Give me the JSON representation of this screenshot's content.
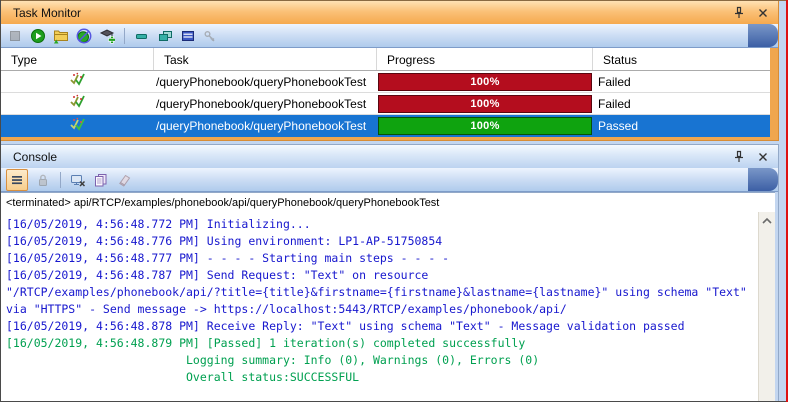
{
  "chrome": {
    "background_color": "#C3D6F0",
    "right_border_color": "#DE1212"
  },
  "task_monitor": {
    "title": "Task Monitor",
    "window_icons": [
      "pin-icon",
      "close-icon"
    ],
    "toolbar_icons": [
      "stop-icon",
      "run-icon",
      "open-folder-icon",
      "disable-logging-icon",
      "add-task-icon",
      "minimize-icon",
      "cascade-windows-icon",
      "maximize-window-icon",
      "key-icon"
    ],
    "accent_color": "#F0A64E",
    "table": {
      "columns": [
        "Type",
        "Task",
        "Progress",
        "Status"
      ],
      "selection_color": "#1874D2",
      "rows": [
        {
          "type_icon": "test-checkmark-icon",
          "task": "/queryPhonebook/queryPhonebookTest",
          "progress": "100%",
          "progress_color": "#B40D1E",
          "status": "Failed",
          "selected": false
        },
        {
          "type_icon": "test-checkmark-icon",
          "task": "/queryPhonebook/queryPhonebookTest",
          "progress": "100%",
          "progress_color": "#B40D1E",
          "status": "Failed",
          "selected": false
        },
        {
          "type_icon": "test-checkmark-icon",
          "task": "/queryPhonebook/queryPhonebookTest",
          "progress": "100%",
          "progress_color": "#0FA30F",
          "status": "Passed",
          "selected": true
        }
      ]
    }
  },
  "console": {
    "title": "Console",
    "window_icons": [
      "pin-icon",
      "close-icon"
    ],
    "toolbar_icons": [
      "show-console-menu-icon",
      "scroll-lock-icon",
      "remove-launch-icon",
      "copy-console-icon",
      "clear-console-icon"
    ],
    "scrollbar_icons": [
      "scroll-up-icon"
    ],
    "terminated_line": "<terminated> api/RTCP/examples/phonebook/api/queryPhonebook/queryPhonebookTest",
    "text_colors": {
      "info": "#1717CE",
      "success": "#00A050"
    },
    "lines": [
      {
        "text": "[16/05/2019, 4:56:48.772 PM] Initializing...",
        "color": "#1717CE"
      },
      {
        "text": "[16/05/2019, 4:56:48.776 PM] Using environment: LP1-AP-51750854",
        "color": "#1717CE"
      },
      {
        "text": "[16/05/2019, 4:56:48.777 PM] - - - - Starting main steps - - - -",
        "color": "#1717CE"
      },
      {
        "text": "[16/05/2019, 4:56:48.787 PM] Send Request: \"Text\" on resource",
        "color": "#1717CE"
      },
      {
        "text": "\"/RTCP/examples/phonebook/api/?title={title}&firstname={firstname}&lastname={lastname}\" using schema \"Text\"",
        "color": "#1717CE"
      },
      {
        "text": "via \"HTTPS\" - Send message -> https://localhost:5443/RTCP/examples/phonebook/api/",
        "color": "#1717CE"
      },
      {
        "text": "[16/05/2019, 4:56:48.878 PM] Receive Reply: \"Text\" using schema \"Text\" - Message validation passed",
        "color": "#1717CE"
      },
      {
        "text": "[16/05/2019, 4:56:48.879 PM] [Passed] 1 iteration(s) completed successfully",
        "color": "#00A050"
      },
      {
        "text": "                          Logging summary: Info (0), Warnings (0), Errors (0)",
        "color": "#00A050"
      },
      {
        "text": "                          Overall status:SUCCESSFUL",
        "color": "#00A050"
      }
    ]
  }
}
